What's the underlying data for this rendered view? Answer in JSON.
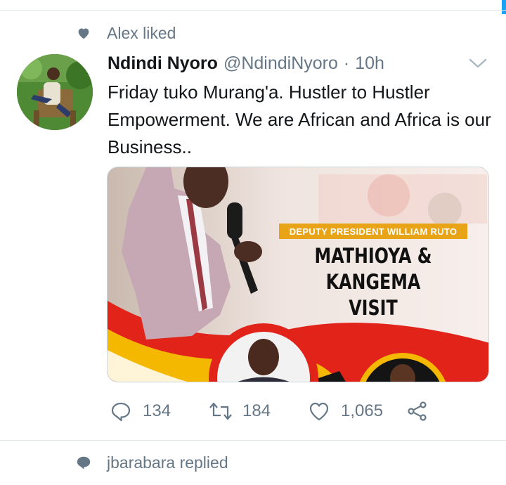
{
  "colors": {
    "secondary_text": "#657786",
    "primary_text": "#14171a",
    "divider": "#e1e8ed",
    "accent": "#1da1f2"
  },
  "context_top": {
    "icon": "heart-icon",
    "text": "Alex liked"
  },
  "tweet": {
    "display_name": "Ndindi Nyoro",
    "handle": "@NdindiNyoro",
    "separator": "·",
    "time": "10h",
    "text": "Friday tuko Murang'a. Hustler to Hustler Empowerment. We are African and Africa is our Business..",
    "media": {
      "banner": "DEPUTY PRESIDENT WILLIAM RUTO",
      "headline_1": "MATHIOYA & KANGEMA",
      "headline_2": "VISIT"
    },
    "actions": {
      "reply": {
        "icon": "reply-icon",
        "count": "134"
      },
      "retweet": {
        "icon": "retweet-icon",
        "count": "184"
      },
      "like": {
        "icon": "heart-outline-icon",
        "count": "1,065"
      },
      "share": {
        "icon": "share-icon"
      }
    }
  },
  "context_bottom": {
    "icon": "speech-bubble-icon",
    "text": "jbarabara replied"
  }
}
